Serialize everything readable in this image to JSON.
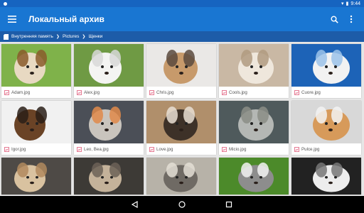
{
  "status_bar": {
    "time": "9:44"
  },
  "app_bar": {
    "title": "Локальный архив",
    "menu_icon": "hamburger-menu-icon",
    "search_icon": "search-icon",
    "overflow_icon": "more-vert-icon",
    "color": "#1976d2"
  },
  "breadcrumb": {
    "items": [
      "Внутренняя память",
      "Pictures",
      "Щенки"
    ]
  },
  "grid": {
    "items": [
      {
        "file": "Adam.jpg",
        "palette": [
          "#7fb24a",
          "#e8d9c2",
          "#8a5a2b"
        ]
      },
      {
        "file": "Alex.jpg",
        "palette": [
          "#6f9a44",
          "#f4f4f2",
          "#d8d8d8"
        ]
      },
      {
        "file": "Chris.jpg",
        "palette": [
          "#eae8e6",
          "#c79a6b",
          "#5a4a3e"
        ]
      },
      {
        "file": "Cools.jpg",
        "palette": [
          "#c9b8a4",
          "#efe7dc",
          "#b09a80"
        ]
      },
      {
        "file": "Cuore.jpg",
        "palette": [
          "#1d63b7",
          "#f2f2f2",
          "#9cc3ea"
        ]
      },
      {
        "file": "Igor.jpg",
        "palette": [
          "#f1f1f1",
          "#6a4326",
          "#2a1f18"
        ]
      },
      {
        "file": "Leo, Bea.jpg",
        "palette": [
          "#4b4f57",
          "#c9c4bd",
          "#e08a4a"
        ]
      },
      {
        "file": "Love.jpg",
        "palette": [
          "#b08f6b",
          "#3d3128",
          "#e9dfd3"
        ]
      },
      {
        "file": "Micio.jpg",
        "palette": [
          "#4f5a5c",
          "#b4b7b4",
          "#8b8e86"
        ]
      },
      {
        "file": "Pulce.jpg",
        "palette": [
          "#d8d8d8",
          "#d79a5a",
          "#f3f3f3"
        ]
      },
      {
        "file": "",
        "palette": [
          "#4e4a46",
          "#d9c2a0",
          "#b28a5e"
        ]
      },
      {
        "file": "",
        "palette": [
          "#3d3a36",
          "#c4b29a",
          "#6c6257"
        ]
      },
      {
        "file": "",
        "palette": [
          "#b7b2a8",
          "#6f6a64",
          "#e4ded5"
        ]
      },
      {
        "file": "",
        "palette": [
          "#4c8a2a",
          "#8d8d8d",
          "#f2f2f2"
        ]
      },
      {
        "file": "",
        "palette": [
          "#222222",
          "#ededed",
          "#777777"
        ]
      }
    ]
  },
  "nav_bar": {
    "back_icon": "back-triangle-icon",
    "home_icon": "home-circle-icon",
    "recents_icon": "recents-square-icon"
  }
}
